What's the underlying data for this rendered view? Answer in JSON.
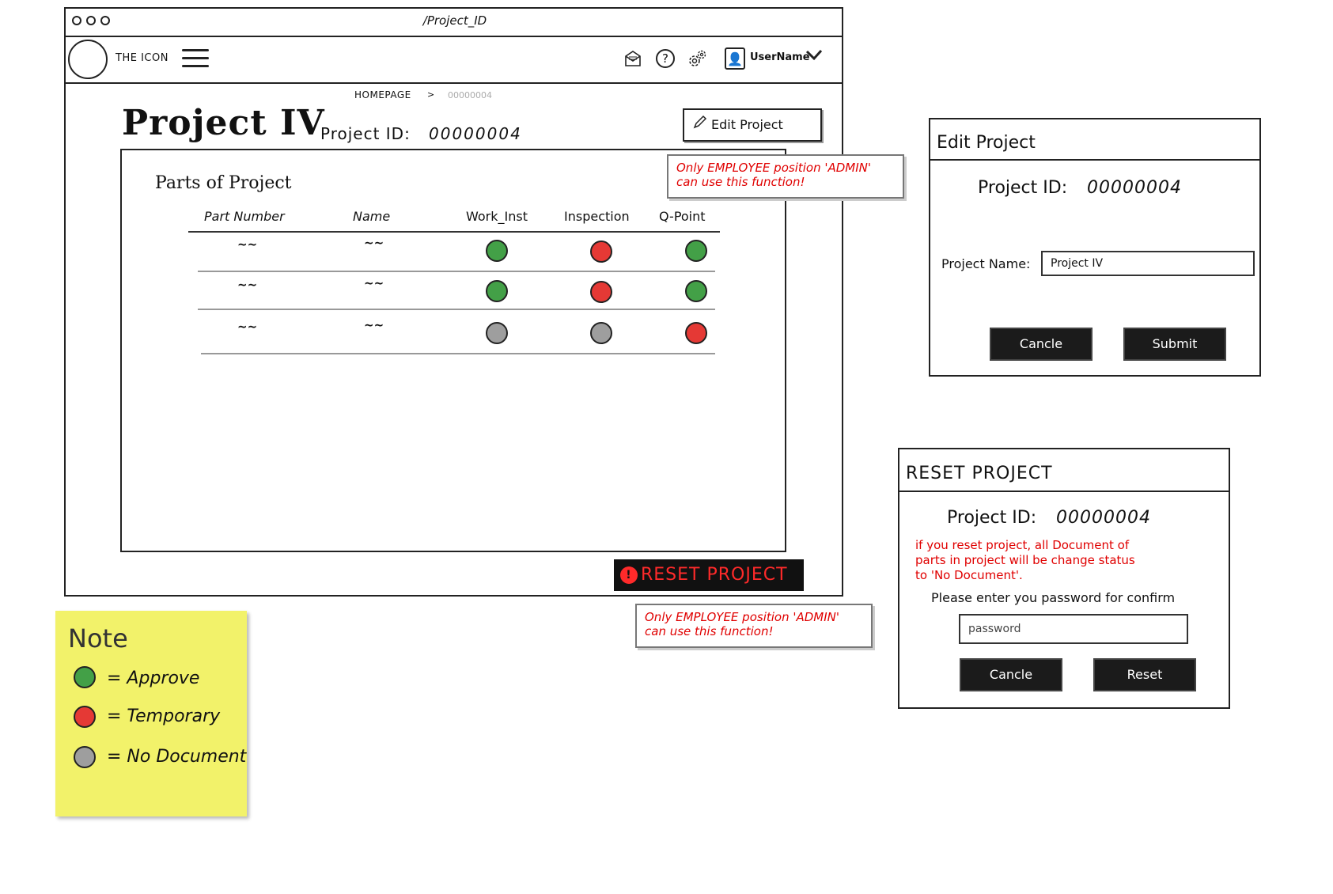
{
  "window": {
    "url": "/Project_ID"
  },
  "nav": {
    "logo_text": "THE ICON",
    "username": "UserName"
  },
  "breadcrumb": {
    "home": "HOMEPAGE",
    "sep": ">",
    "current": "00000004"
  },
  "project": {
    "title": "Project IV",
    "id_label": "Project ID:",
    "id_value": "00000004",
    "edit_label": "Edit Project"
  },
  "parts": {
    "title": "Parts of Project",
    "headers": [
      "Part Number",
      "Name",
      "Work_Inst",
      "Inspection",
      "Q-Point"
    ],
    "rows": [
      {
        "part": "~~",
        "name": "~~",
        "work_inst": "green",
        "inspection": "red",
        "q_point": "green"
      },
      {
        "part": "~~",
        "name": "~~",
        "work_inst": "green",
        "inspection": "red",
        "q_point": "green"
      },
      {
        "part": "~~",
        "name": "~~",
        "work_inst": "grey",
        "inspection": "grey",
        "q_point": "red"
      }
    ]
  },
  "callouts": {
    "edit": "Only EMPLOYEE position 'ADMIN' can use this function!",
    "reset": "Only EMPLOYEE position 'ADMIN' can use this function!"
  },
  "reset_button": {
    "label": "RESET PROJECT"
  },
  "note": {
    "title": "Note",
    "items": [
      {
        "color": "#43a047",
        "label": "= Approve"
      },
      {
        "color": "#e53935",
        "label": "= Temporary"
      },
      {
        "color": "#9e9e9e",
        "label": "= No Document"
      }
    ]
  },
  "edit_modal": {
    "title": "Edit Project",
    "id_label": "Project ID:",
    "id_value": "00000004",
    "name_label": "Project Name:",
    "name_value": "Project IV",
    "cancel_label": "Cancle",
    "submit_label": "Submit"
  },
  "reset_modal": {
    "title": "RESET PROJECT",
    "id_label": "Project ID:",
    "id_value": "00000004",
    "warning_1": "if you reset project, all Document of",
    "warning_2": "parts in project will be change status",
    "warning_3": "to 'No Document'.",
    "confirm_text": "Please enter you password for confirm",
    "password_placeholder": "password",
    "cancel_label": "Cancle",
    "reset_label": "Reset"
  }
}
